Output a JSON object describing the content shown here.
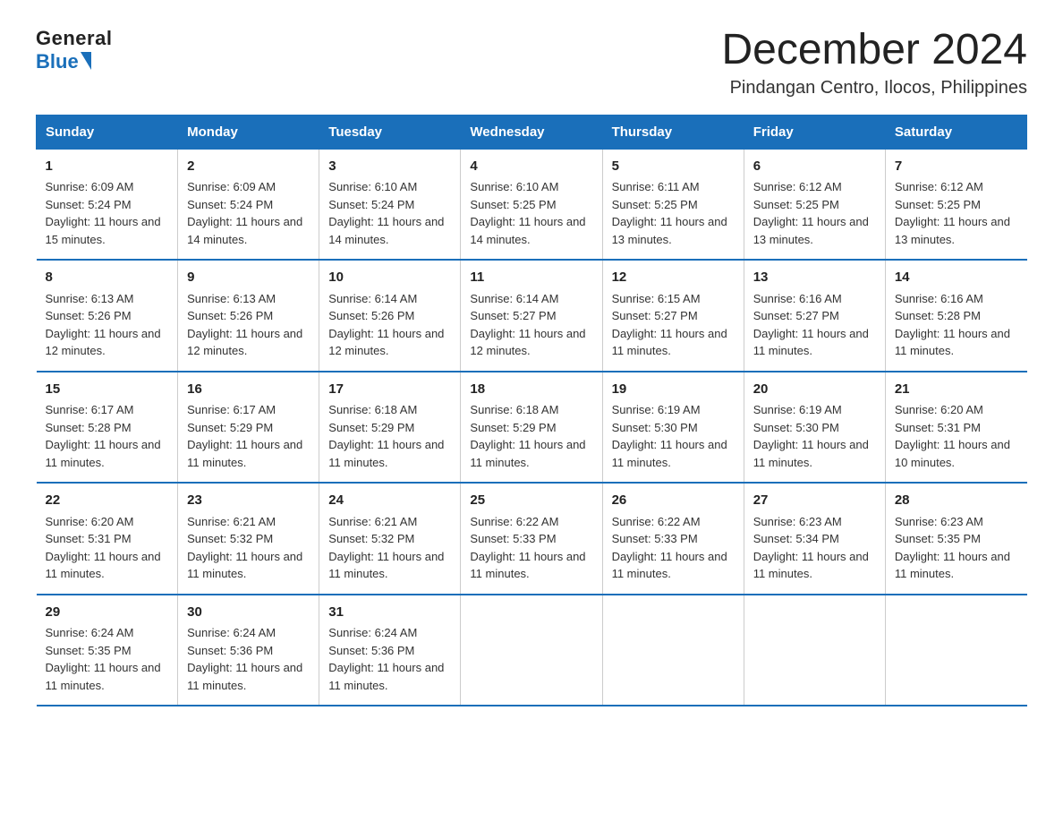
{
  "logo": {
    "general": "General",
    "blue": "Blue"
  },
  "title": "December 2024",
  "subtitle": "Pindangan Centro, Ilocos, Philippines",
  "headers": [
    "Sunday",
    "Monday",
    "Tuesday",
    "Wednesday",
    "Thursday",
    "Friday",
    "Saturday"
  ],
  "weeks": [
    [
      {
        "day": "1",
        "sunrise": "6:09 AM",
        "sunset": "5:24 PM",
        "daylight": "11 hours and 15 minutes."
      },
      {
        "day": "2",
        "sunrise": "6:09 AM",
        "sunset": "5:24 PM",
        "daylight": "11 hours and 14 minutes."
      },
      {
        "day": "3",
        "sunrise": "6:10 AM",
        "sunset": "5:24 PM",
        "daylight": "11 hours and 14 minutes."
      },
      {
        "day": "4",
        "sunrise": "6:10 AM",
        "sunset": "5:25 PM",
        "daylight": "11 hours and 14 minutes."
      },
      {
        "day": "5",
        "sunrise": "6:11 AM",
        "sunset": "5:25 PM",
        "daylight": "11 hours and 13 minutes."
      },
      {
        "day": "6",
        "sunrise": "6:12 AM",
        "sunset": "5:25 PM",
        "daylight": "11 hours and 13 minutes."
      },
      {
        "day": "7",
        "sunrise": "6:12 AM",
        "sunset": "5:25 PM",
        "daylight": "11 hours and 13 minutes."
      }
    ],
    [
      {
        "day": "8",
        "sunrise": "6:13 AM",
        "sunset": "5:26 PM",
        "daylight": "11 hours and 12 minutes."
      },
      {
        "day": "9",
        "sunrise": "6:13 AM",
        "sunset": "5:26 PM",
        "daylight": "11 hours and 12 minutes."
      },
      {
        "day": "10",
        "sunrise": "6:14 AM",
        "sunset": "5:26 PM",
        "daylight": "11 hours and 12 minutes."
      },
      {
        "day": "11",
        "sunrise": "6:14 AM",
        "sunset": "5:27 PM",
        "daylight": "11 hours and 12 minutes."
      },
      {
        "day": "12",
        "sunrise": "6:15 AM",
        "sunset": "5:27 PM",
        "daylight": "11 hours and 11 minutes."
      },
      {
        "day": "13",
        "sunrise": "6:16 AM",
        "sunset": "5:27 PM",
        "daylight": "11 hours and 11 minutes."
      },
      {
        "day": "14",
        "sunrise": "6:16 AM",
        "sunset": "5:28 PM",
        "daylight": "11 hours and 11 minutes."
      }
    ],
    [
      {
        "day": "15",
        "sunrise": "6:17 AM",
        "sunset": "5:28 PM",
        "daylight": "11 hours and 11 minutes."
      },
      {
        "day": "16",
        "sunrise": "6:17 AM",
        "sunset": "5:29 PM",
        "daylight": "11 hours and 11 minutes."
      },
      {
        "day": "17",
        "sunrise": "6:18 AM",
        "sunset": "5:29 PM",
        "daylight": "11 hours and 11 minutes."
      },
      {
        "day": "18",
        "sunrise": "6:18 AM",
        "sunset": "5:29 PM",
        "daylight": "11 hours and 11 minutes."
      },
      {
        "day": "19",
        "sunrise": "6:19 AM",
        "sunset": "5:30 PM",
        "daylight": "11 hours and 11 minutes."
      },
      {
        "day": "20",
        "sunrise": "6:19 AM",
        "sunset": "5:30 PM",
        "daylight": "11 hours and 11 minutes."
      },
      {
        "day": "21",
        "sunrise": "6:20 AM",
        "sunset": "5:31 PM",
        "daylight": "11 hours and 10 minutes."
      }
    ],
    [
      {
        "day": "22",
        "sunrise": "6:20 AM",
        "sunset": "5:31 PM",
        "daylight": "11 hours and 11 minutes."
      },
      {
        "day": "23",
        "sunrise": "6:21 AM",
        "sunset": "5:32 PM",
        "daylight": "11 hours and 11 minutes."
      },
      {
        "day": "24",
        "sunrise": "6:21 AM",
        "sunset": "5:32 PM",
        "daylight": "11 hours and 11 minutes."
      },
      {
        "day": "25",
        "sunrise": "6:22 AM",
        "sunset": "5:33 PM",
        "daylight": "11 hours and 11 minutes."
      },
      {
        "day": "26",
        "sunrise": "6:22 AM",
        "sunset": "5:33 PM",
        "daylight": "11 hours and 11 minutes."
      },
      {
        "day": "27",
        "sunrise": "6:23 AM",
        "sunset": "5:34 PM",
        "daylight": "11 hours and 11 minutes."
      },
      {
        "day": "28",
        "sunrise": "6:23 AM",
        "sunset": "5:35 PM",
        "daylight": "11 hours and 11 minutes."
      }
    ],
    [
      {
        "day": "29",
        "sunrise": "6:24 AM",
        "sunset": "5:35 PM",
        "daylight": "11 hours and 11 minutes."
      },
      {
        "day": "30",
        "sunrise": "6:24 AM",
        "sunset": "5:36 PM",
        "daylight": "11 hours and 11 minutes."
      },
      {
        "day": "31",
        "sunrise": "6:24 AM",
        "sunset": "5:36 PM",
        "daylight": "11 hours and 11 minutes."
      },
      {
        "day": "",
        "sunrise": "",
        "sunset": "",
        "daylight": ""
      },
      {
        "day": "",
        "sunrise": "",
        "sunset": "",
        "daylight": ""
      },
      {
        "day": "",
        "sunrise": "",
        "sunset": "",
        "daylight": ""
      },
      {
        "day": "",
        "sunrise": "",
        "sunset": "",
        "daylight": ""
      }
    ]
  ]
}
